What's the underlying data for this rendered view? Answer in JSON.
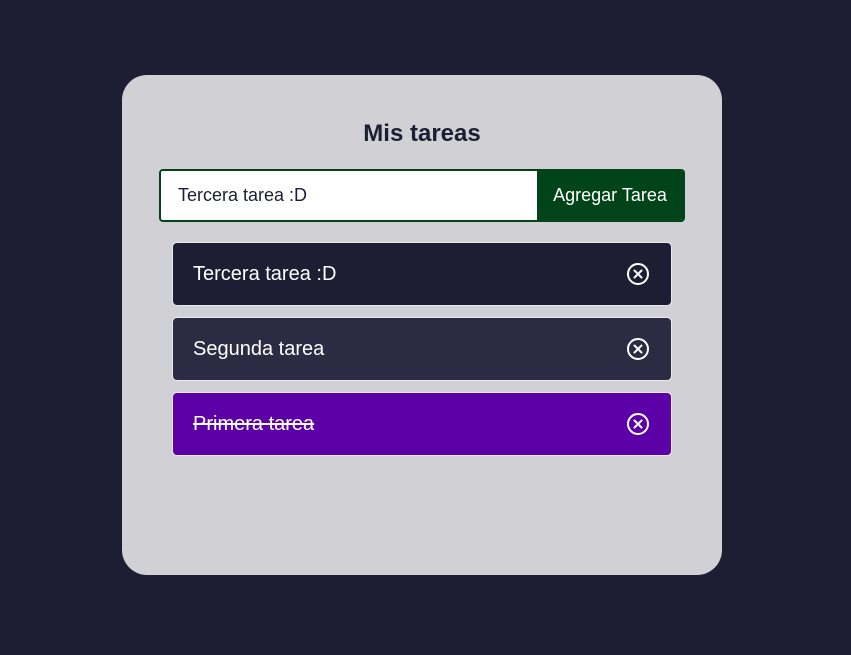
{
  "app": {
    "title": "Mis tareas"
  },
  "form": {
    "input_value": "Tercera tarea :D",
    "add_label": "Agregar Tarea"
  },
  "tasks": [
    {
      "text": "Tercera tarea :D",
      "completed": false,
      "color": "#1d1e33"
    },
    {
      "text": "Segunda tarea",
      "completed": false,
      "color": "#2b2c44"
    },
    {
      "text": "Primera tarea",
      "completed": true,
      "color": "#5c00a8"
    }
  ],
  "icons": {
    "delete": "close-circle-icon"
  },
  "colors": {
    "background": "#1d1e33",
    "card": "#d1d0d5",
    "accent": "#014419",
    "completed": "#5c00a8"
  }
}
